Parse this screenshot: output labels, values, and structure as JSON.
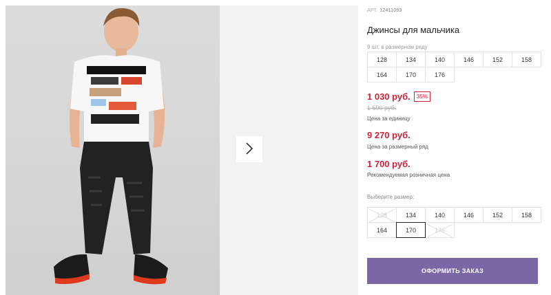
{
  "gallery": {
    "next_icon": "chevron-right-icon"
  },
  "product": {
    "article_label": "АРТ.",
    "article_value": "12411093",
    "title": "Джинсы для мальчика",
    "pack_note": "9 шт. в размерном ряду",
    "pack_sizes": [
      "128",
      "134",
      "140",
      "146",
      "152",
      "158",
      "164",
      "170",
      "176"
    ]
  },
  "prices": {
    "unit_price": "1 030 руб.",
    "discount": "35%",
    "old_price": "1 590 руб.",
    "unit_label": "Цена за единицу",
    "row_price": "9 270 руб.",
    "row_label": "Цена за размерный ряд",
    "rrp_price": "1 700 руб.",
    "rrp_label": "Рекомендуемая розничная цена"
  },
  "size_select": {
    "label": "Выберите размер:",
    "sizes": [
      {
        "label": "128",
        "state": "disabled"
      },
      {
        "label": "134",
        "state": "available"
      },
      {
        "label": "140",
        "state": "available"
      },
      {
        "label": "146",
        "state": "available"
      },
      {
        "label": "152",
        "state": "available"
      },
      {
        "label": "158",
        "state": "available"
      },
      {
        "label": "164",
        "state": "available"
      },
      {
        "label": "170",
        "state": "selected"
      },
      {
        "label": "176",
        "state": "disabled"
      }
    ]
  },
  "order_button": "ОФОРМИТЬ ЗАКАЗ",
  "colors": {
    "price": "#d0213a",
    "button": "#7c67a6"
  }
}
